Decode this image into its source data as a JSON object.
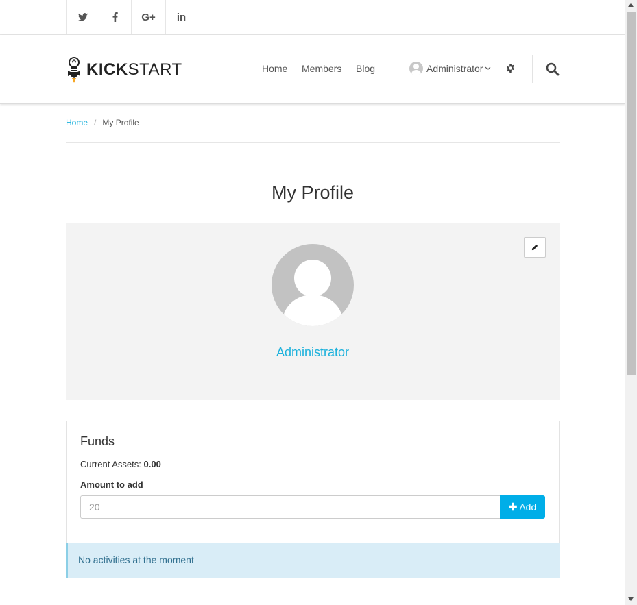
{
  "social": {
    "items": [
      {
        "icon": "twitter-icon"
      },
      {
        "icon": "facebook-icon"
      },
      {
        "icon": "google-plus-icon",
        "text": "G+"
      },
      {
        "icon": "linkedin-icon",
        "text": "in"
      }
    ]
  },
  "header": {
    "logo_bold": "KICK",
    "logo_light": "START",
    "nav": {
      "home": "Home",
      "members": "Members",
      "blog": "Blog"
    },
    "user": {
      "name": "Administrator"
    }
  },
  "breadcrumb": {
    "home": "Home",
    "separator": "/",
    "current": "My Profile"
  },
  "page_title": "My Profile",
  "profile": {
    "name": "Administrator"
  },
  "funds": {
    "title": "Funds",
    "current_assets_label": "Current Assets:",
    "current_assets_value": "0.00",
    "amount_label": "Amount to add",
    "amount_placeholder": "20",
    "add_button": "Add"
  },
  "alert": {
    "text": "No activities at the moment"
  },
  "colors": {
    "accent": "#1bb1dc",
    "button": "#00aee8",
    "alert_bg": "#d9edf7",
    "alert_text": "#31708f",
    "panel_bg": "#f3f3f3"
  }
}
